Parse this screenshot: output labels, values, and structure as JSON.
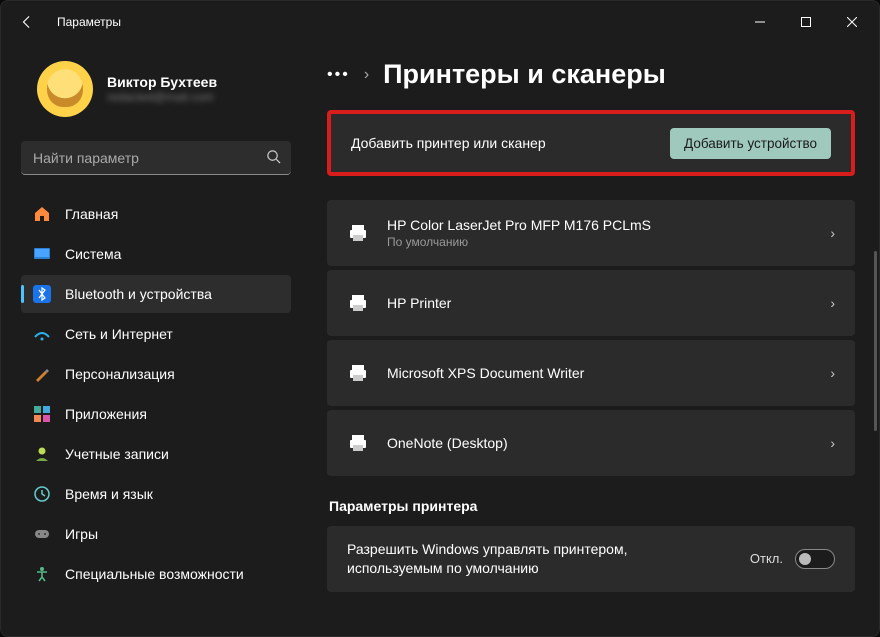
{
  "titlebar": {
    "title": "Параметры"
  },
  "user": {
    "name": "Виктор Бухтеев",
    "email": "redacted@mail.com"
  },
  "search": {
    "placeholder": "Найти параметр"
  },
  "nav": {
    "home": "Главная",
    "system": "Система",
    "bluetooth": "Bluetooth и устройства",
    "network": "Сеть и Интернет",
    "personalization": "Персонализация",
    "apps": "Приложения",
    "accounts": "Учетные записи",
    "time": "Время и язык",
    "gaming": "Игры",
    "accessibility": "Специальные возможности"
  },
  "breadcrumb": {
    "more": "•••",
    "arrow": "›",
    "title": "Принтеры и сканеры"
  },
  "add": {
    "label": "Добавить принтер или сканер",
    "button": "Добавить устройство"
  },
  "printers": [
    {
      "name": "HP Color LaserJet Pro MFP M176 PCLmS",
      "sub": "По умолчанию"
    },
    {
      "name": "HP Printer",
      "sub": ""
    },
    {
      "name": "Microsoft XPS Document Writer",
      "sub": ""
    },
    {
      "name": "OneNote (Desktop)",
      "sub": ""
    }
  ],
  "section": {
    "title": "Параметры принтера"
  },
  "setting": {
    "text": "Разрешить Windows управлять принтером, используемым по умолчанию",
    "toggle_label": "Откл."
  }
}
